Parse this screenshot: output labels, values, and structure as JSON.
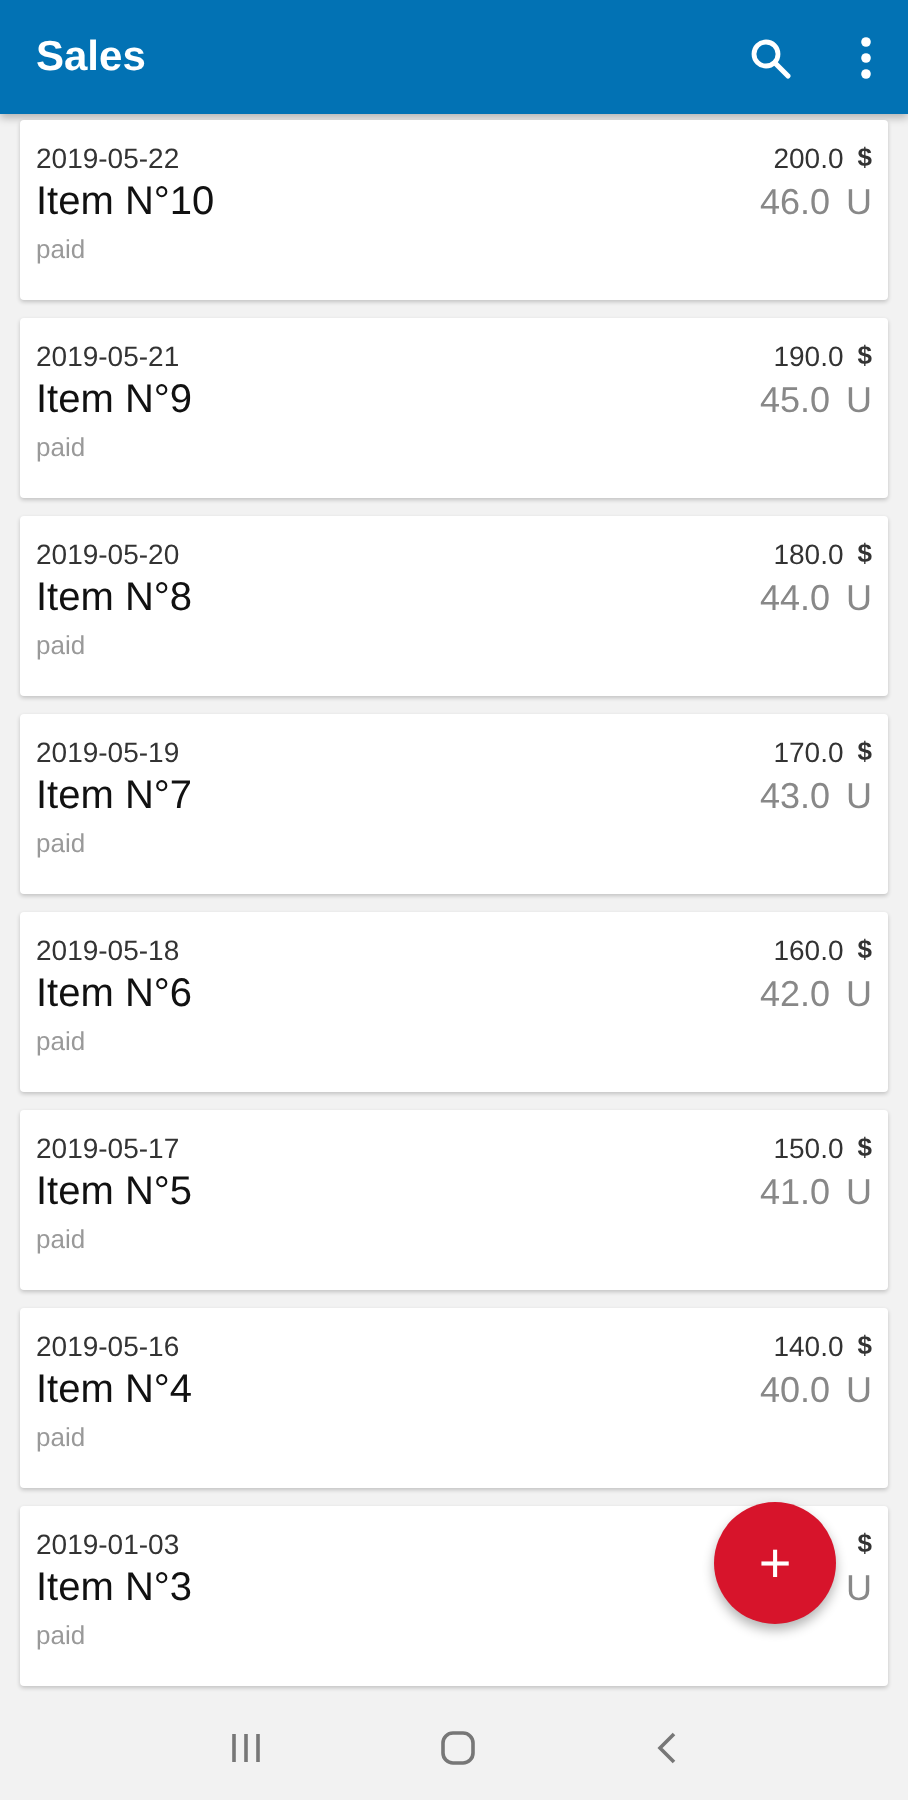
{
  "app_bar": {
    "title": "Sales"
  },
  "sales": [
    {
      "date": "2019-05-22",
      "name": "Item N°10",
      "status": "paid",
      "amount": "200.0",
      "currency": "$",
      "quantity": "46.0",
      "unit": "U"
    },
    {
      "date": "2019-05-21",
      "name": "Item N°9",
      "status": "paid",
      "amount": "190.0",
      "currency": "$",
      "quantity": "45.0",
      "unit": "U"
    },
    {
      "date": "2019-05-20",
      "name": "Item N°8",
      "status": "paid",
      "amount": "180.0",
      "currency": "$",
      "quantity": "44.0",
      "unit": "U"
    },
    {
      "date": "2019-05-19",
      "name": "Item N°7",
      "status": "paid",
      "amount": "170.0",
      "currency": "$",
      "quantity": "43.0",
      "unit": "U"
    },
    {
      "date": "2019-05-18",
      "name": "Item N°6",
      "status": "paid",
      "amount": "160.0",
      "currency": "$",
      "quantity": "42.0",
      "unit": "U"
    },
    {
      "date": "2019-05-17",
      "name": "Item N°5",
      "status": "paid",
      "amount": "150.0",
      "currency": "$",
      "quantity": "41.0",
      "unit": "U"
    },
    {
      "date": "2019-05-16",
      "name": "Item N°4",
      "status": "paid",
      "amount": "140.0",
      "currency": "$",
      "quantity": "40.0",
      "unit": "U"
    },
    {
      "date": "2019-01-03",
      "name": "Item N°3",
      "status": "paid",
      "currency": "$",
      "unit": "U"
    }
  ],
  "fab": {
    "label": "+"
  }
}
